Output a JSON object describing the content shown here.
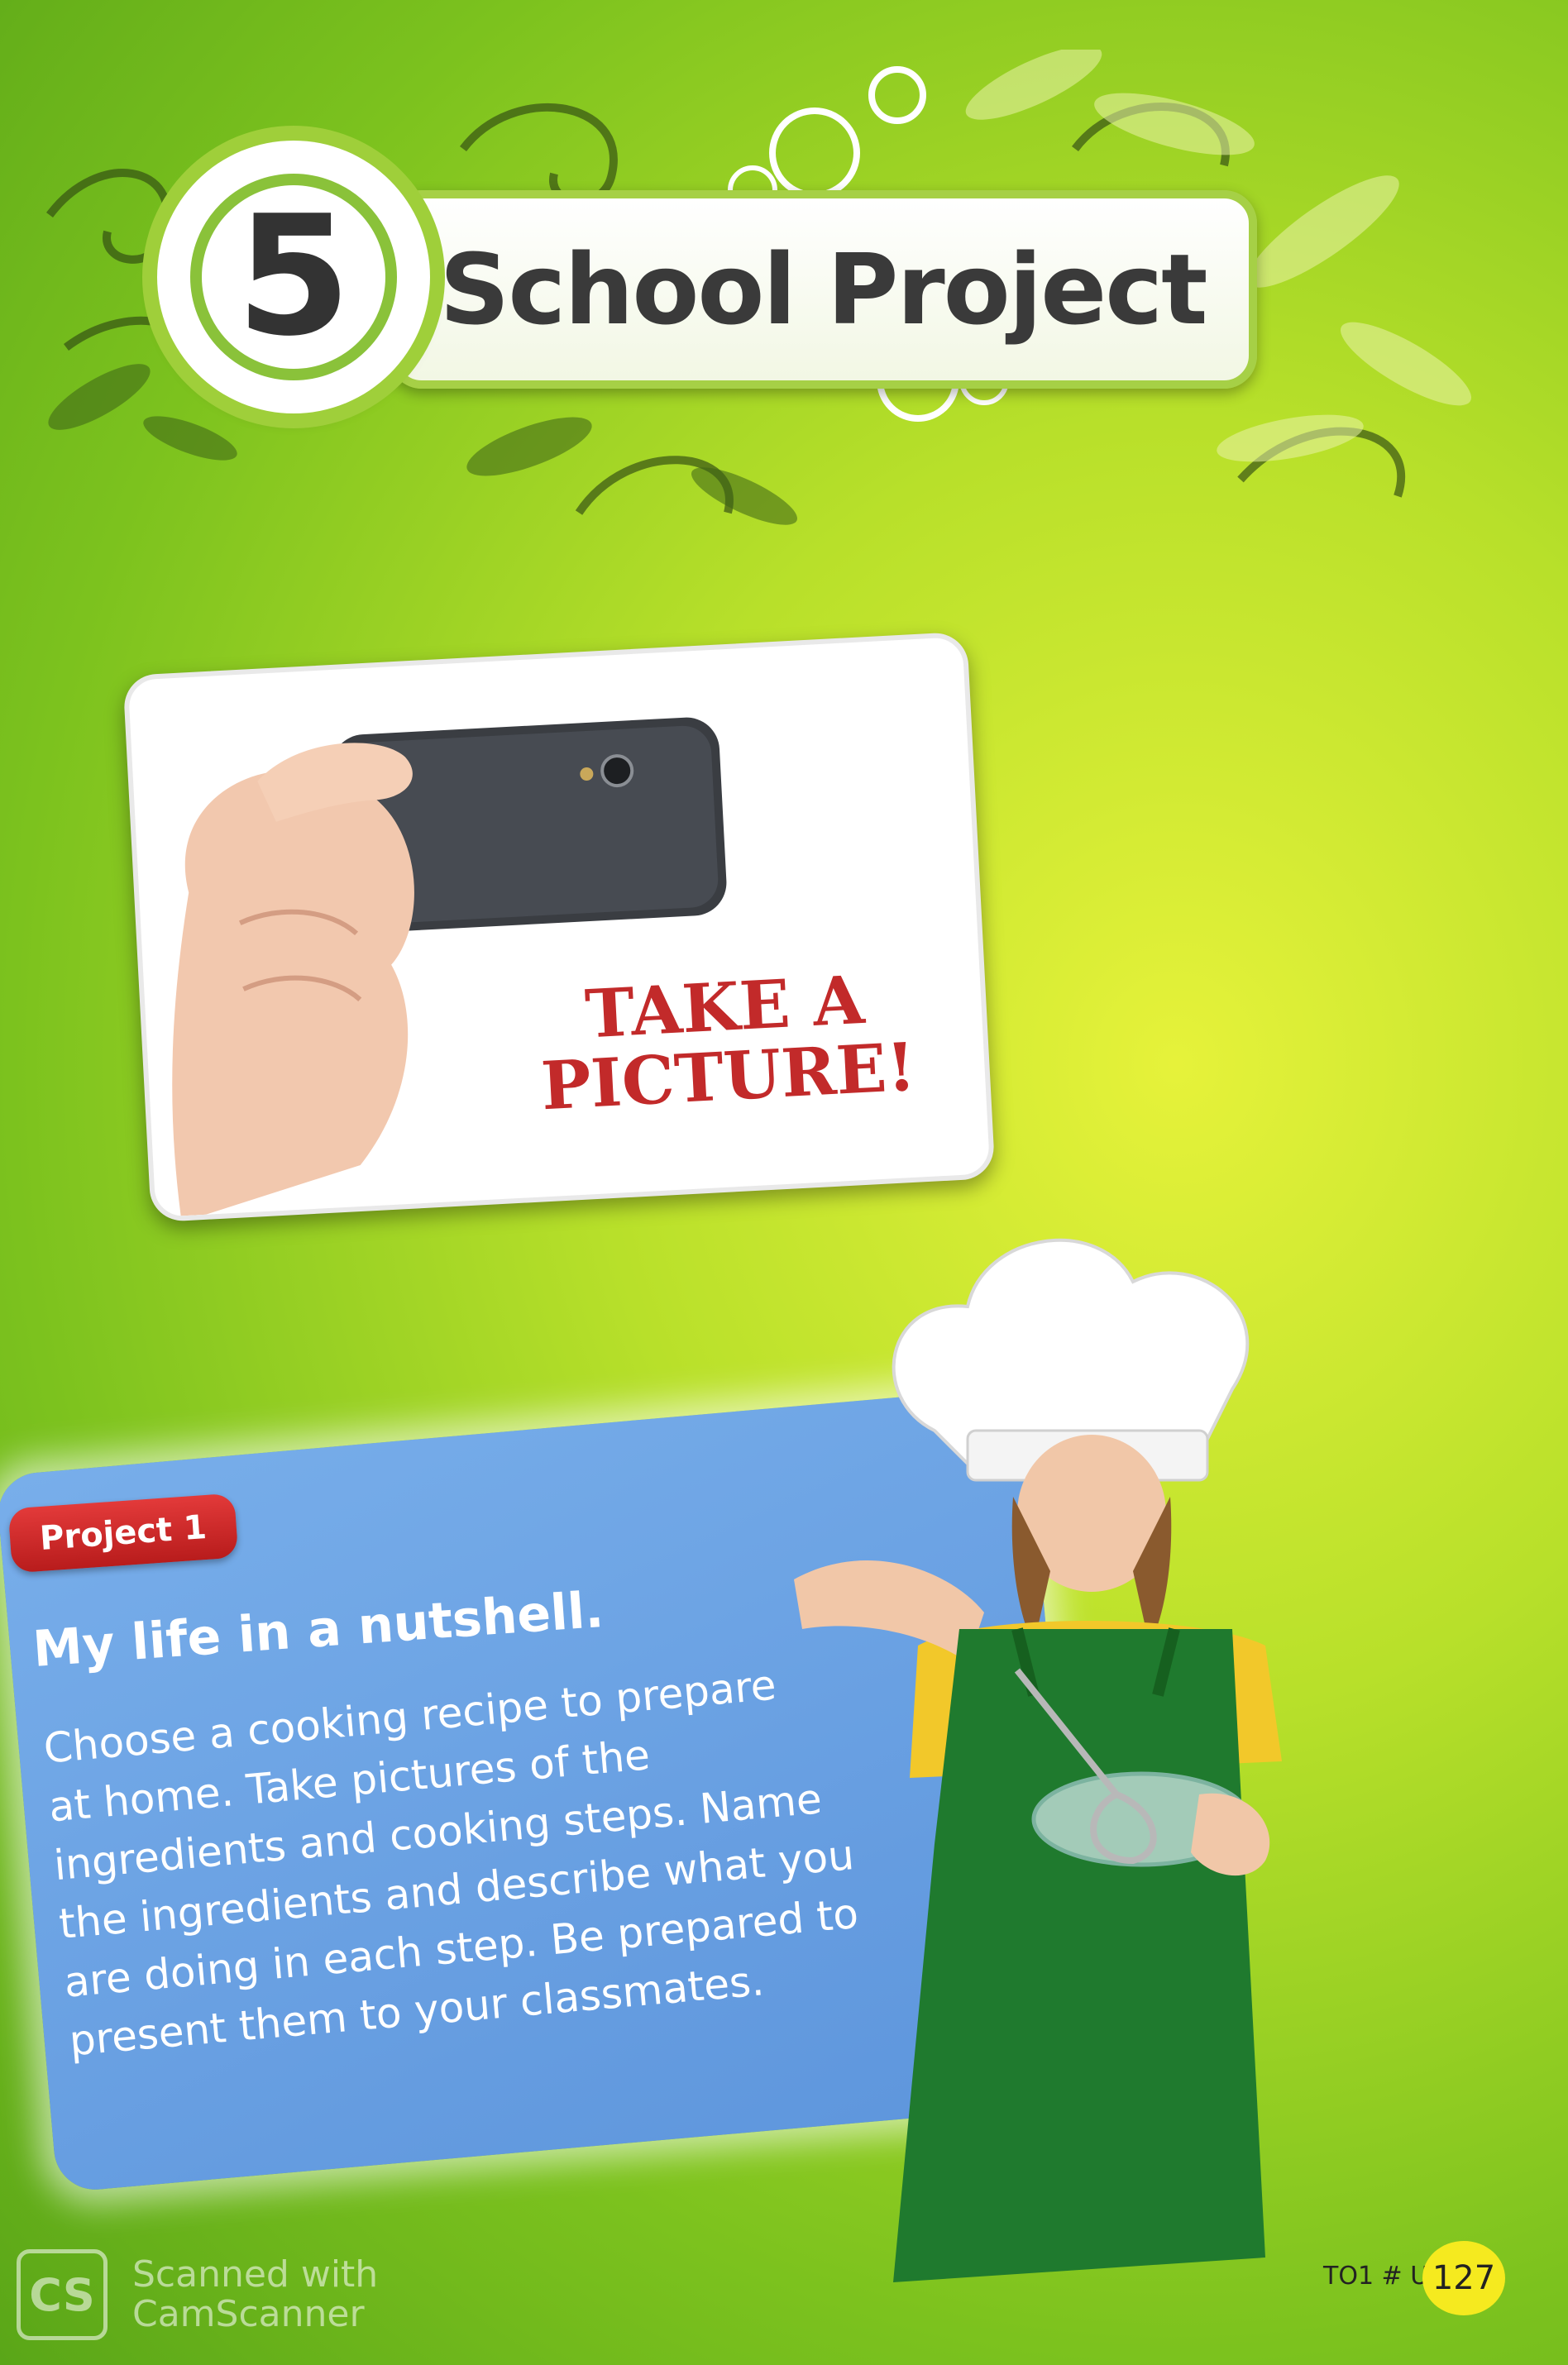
{
  "header": {
    "unit_number": "5",
    "title": "School Project"
  },
  "photo_card": {
    "caption_line1": "TAKE A",
    "caption_line2": "PICTURE!"
  },
  "project": {
    "tag": "Project 1",
    "heading": "My life in a nutshell.",
    "lines": [
      "Choose a cooking recipe to prepare",
      "at home. Take pictures of the",
      "ingredients and cooking steps. Name",
      "the ingredients and describe what you",
      "are doing in each step. Be prepared to",
      "present them to your classmates."
    ]
  },
  "footer": {
    "reference": "TO1 # U5",
    "page_number": "127"
  },
  "watermark": {
    "logo": "CS",
    "line1": "Scanned with",
    "line2": "CamScanner"
  },
  "colors": {
    "background": "#9fd52a",
    "project_box": "#6fa3e6",
    "tag_red": "#d42a2a",
    "caption_red": "#c22a2a",
    "page_badge": "#f5ea1f"
  }
}
